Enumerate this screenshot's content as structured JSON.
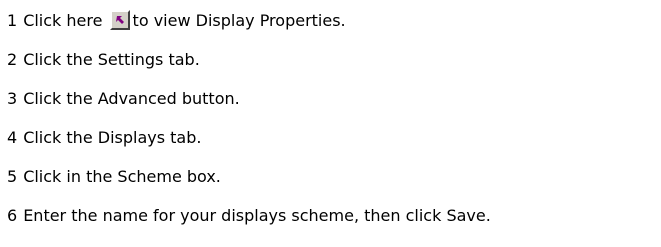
{
  "steps": [
    {
      "number": "1",
      "text_before": "Click here",
      "icon": "shortcut-arrow-icon",
      "text_after": "to view Display Properties."
    },
    {
      "number": "2",
      "text": "Click the Settings tab."
    },
    {
      "number": "3",
      "text": "Click the Advanced button."
    },
    {
      "number": "4",
      "text": "Click the Displays tab."
    },
    {
      "number": "5",
      "text": "Click in the Scheme box."
    },
    {
      "number": "6",
      "text": "Enter the name for your displays scheme, then click Save."
    }
  ],
  "colors": {
    "text": "#000000",
    "background": "#ffffff",
    "button_face": "#d4d0c8",
    "arrow": "#800080"
  }
}
